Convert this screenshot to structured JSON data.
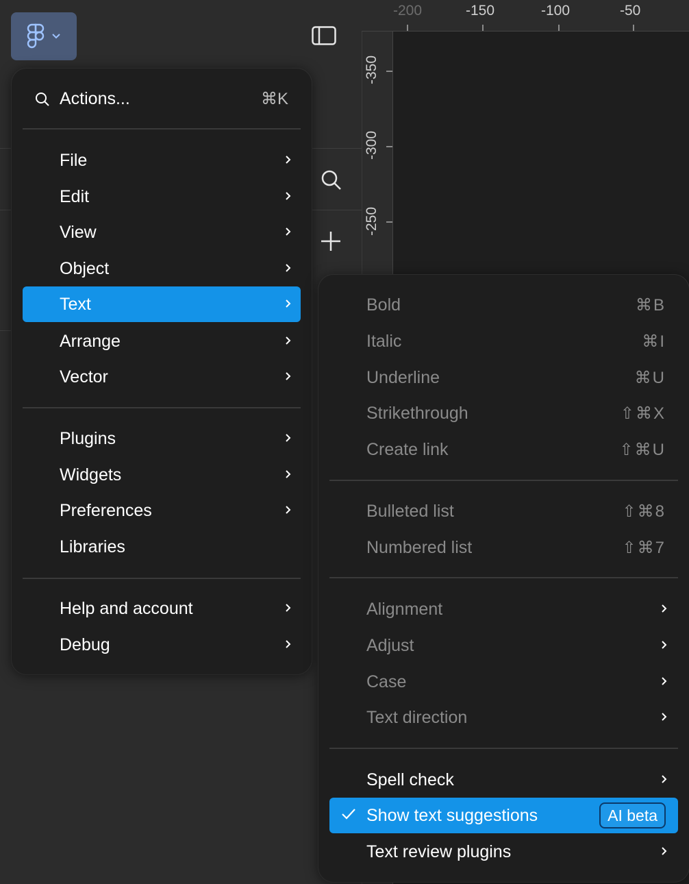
{
  "app": {
    "logo_icon": "figma-logo-icon",
    "logo_dropdown_icon": "chevron-down-icon",
    "accent_color": "#1493e8"
  },
  "ruler": {
    "top_labels": [
      "-200",
      "-150",
      "-100",
      "-50"
    ],
    "left_labels": [
      "-350",
      "-300",
      "-250"
    ]
  },
  "main_menu": {
    "actions_label": "Actions...",
    "actions_shortcut": "⌘K",
    "items": [
      {
        "label": "File"
      },
      {
        "label": "Edit"
      },
      {
        "label": "View"
      },
      {
        "label": "Object"
      },
      {
        "label": "Text"
      },
      {
        "label": "Arrange"
      },
      {
        "label": "Vector"
      },
      {
        "label": "Plugins"
      },
      {
        "label": "Widgets"
      },
      {
        "label": "Preferences"
      },
      {
        "label": "Libraries"
      },
      {
        "label": "Help and account"
      },
      {
        "label": "Debug"
      }
    ]
  },
  "text_submenu": {
    "items": [
      {
        "label": "Bold",
        "shortcut": "⌘B"
      },
      {
        "label": "Italic",
        "shortcut": "⌘I"
      },
      {
        "label": "Underline",
        "shortcut": "⌘U"
      },
      {
        "label": "Strikethrough",
        "shortcut": "⇧⌘X"
      },
      {
        "label": "Create link",
        "shortcut": "⇧⌘U"
      },
      {
        "label": "Bulleted list",
        "shortcut": "⇧⌘8"
      },
      {
        "label": "Numbered list",
        "shortcut": "⇧⌘7"
      },
      {
        "label": "Alignment"
      },
      {
        "label": "Adjust"
      },
      {
        "label": "Case"
      },
      {
        "label": "Text direction"
      },
      {
        "label": "Spell check"
      },
      {
        "label": "Show text suggestions",
        "badge": "AI beta"
      },
      {
        "label": "Text review plugins"
      }
    ]
  }
}
